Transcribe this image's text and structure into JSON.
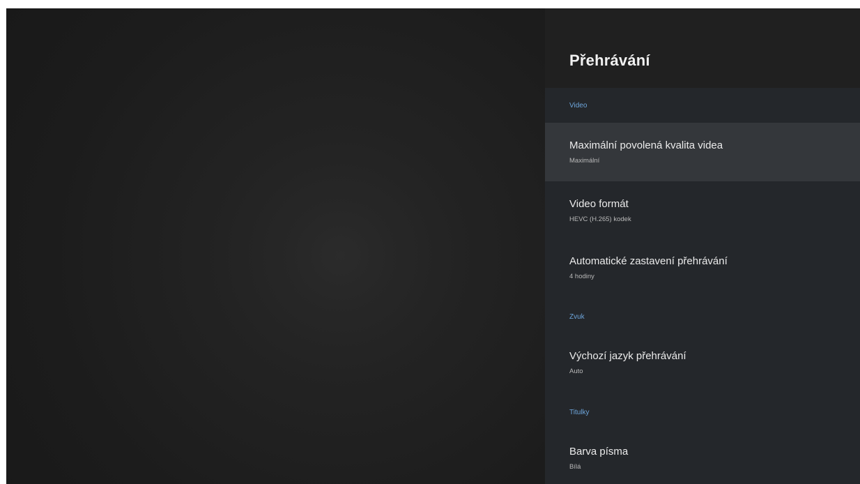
{
  "panel": {
    "title": "Přehrávání",
    "sections": {
      "video": "Video",
      "audio": "Zvuk",
      "subtitles": "Titulky"
    },
    "items": [
      {
        "title": "Maximální povolená kvalita videa",
        "value": "Maximální"
      },
      {
        "title": "Video formát",
        "value": "HEVC (H.265) kodek"
      },
      {
        "title": "Automatické zastavení přehrávání",
        "value": "4 hodiny"
      },
      {
        "title": "Výchozí jazyk přehrávání",
        "value": "Auto"
      },
      {
        "title": "Barva písma",
        "value": "Bílá"
      }
    ]
  },
  "colors": {
    "accent": "#6ea6dc",
    "panel_bg": "#24272b",
    "header_bg": "#202020",
    "focused_bg": "#34373b"
  }
}
